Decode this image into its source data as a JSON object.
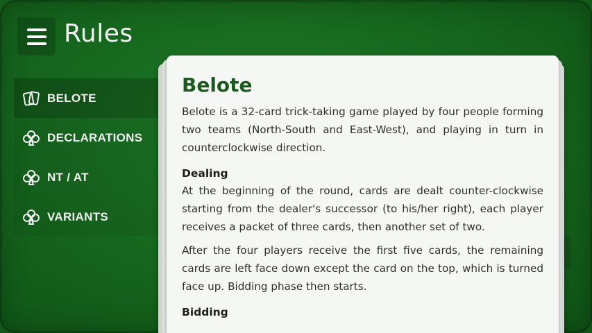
{
  "header": {
    "title": "Rules"
  },
  "sidebar": {
    "items": [
      {
        "label": "BELOTE",
        "icon": "cards-icon",
        "active": true
      },
      {
        "label": "DECLARATIONS",
        "icon": "club-icon",
        "active": false
      },
      {
        "label": "NT / AT",
        "icon": "club-icon",
        "active": false
      },
      {
        "label": "VARIANTS",
        "icon": "club-icon",
        "active": false
      }
    ]
  },
  "content": {
    "heading": "Belote",
    "intro": "Belote is a 32-card trick-taking game played by four people forming two teams (North-South and East-West), and playing in turn in counterclockwise direction.",
    "sections": [
      {
        "title": "Dealing",
        "paragraphs": [
          "At the beginning of the round, cards are dealt counter-clockwise starting from the dealer's successor (to his/her right), each player receives a packet of three cards, then another set of two.",
          "After the four players receive the first five cards, the remaining cards are left face down except the card on the top, which is turned face up. Bidding phase then starts."
        ]
      },
      {
        "title": "Bidding",
        "paragraphs": []
      }
    ]
  },
  "colors": {
    "felt": "#17681f",
    "heading": "#1d5a1d",
    "card": "#f5f7f5"
  }
}
